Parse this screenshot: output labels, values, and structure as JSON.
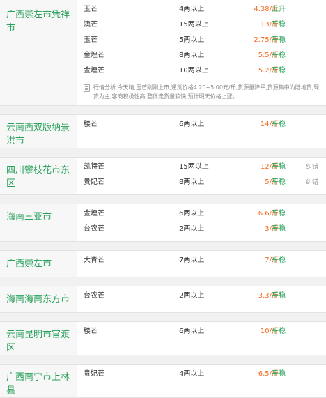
{
  "blocks": [
    {
      "region": "广西崇左市凭祥市",
      "rows": [
        {
          "name": "玉芒",
          "amount": "4两以上",
          "price": "4.38/斤",
          "trend": "上升",
          "tag": ""
        },
        {
          "name": "澳芒",
          "amount": "15两以上",
          "price": "13/斤",
          "trend": "平稳",
          "tag": ""
        },
        {
          "name": "玉芒",
          "amount": "5两以上",
          "price": "2.75/斤",
          "trend": "平稳",
          "tag": ""
        },
        {
          "name": "金煌芒",
          "amount": "8两以上",
          "price": "5.5/斤",
          "trend": "平稳",
          "tag": ""
        },
        {
          "name": "金煌芒",
          "amount": "10两以上",
          "price": "5.2/斤",
          "trend": "平稳",
          "tag": ""
        }
      ],
      "analysis": "行情分析 今天晴,玉芒刚刚上市,通货价格4.20~5.00元/斤,货源量降平,货源集中为陆地货,现货为主,客商积极性高,整体走货量较快,预计明天价格上涨。"
    },
    {
      "region": "云南西双版纳景洪市",
      "rows": [
        {
          "name": "腰芒",
          "amount": "6两以上",
          "price": "14/斤",
          "trend": "平稳",
          "tag": ""
        }
      ]
    },
    {
      "region": "四川攀枝花市东区",
      "rows": [
        {
          "name": "凯特芒",
          "amount": "15两以上",
          "price": "12/斤",
          "trend": "平稳",
          "tag": "纠错"
        },
        {
          "name": "贵妃芒",
          "amount": "8两以上",
          "price": "5/斤",
          "trend": "平稳",
          "tag": "纠错"
        }
      ]
    },
    {
      "region": "海南三亚市",
      "rows": [
        {
          "name": "金煌芒",
          "amount": "6两以上",
          "price": "6.6/斤",
          "trend": "平稳",
          "tag": ""
        },
        {
          "name": "台农芒",
          "amount": "2两以上",
          "price": "3/斤",
          "trend": "平稳",
          "tag": ""
        }
      ]
    },
    {
      "region": "广西崇左市",
      "rows": [
        {
          "name": "大青芒",
          "amount": "7两以上",
          "price": "7/斤",
          "trend": "平稳",
          "tag": ""
        }
      ]
    },
    {
      "region": "海南海南东方市",
      "rows": [
        {
          "name": "台农芒",
          "amount": "2两以上",
          "price": "3.3/斤",
          "trend": "平稳",
          "tag": ""
        }
      ]
    },
    {
      "region": "云南昆明市官渡区",
      "rows": [
        {
          "name": "腰芒",
          "amount": "6两以上",
          "price": "10/斤",
          "trend": "平稳",
          "tag": ""
        }
      ]
    },
    {
      "region": "广西南宁市上林县",
      "rows": [
        {
          "name": "贵妃芒",
          "amount": "4两以上",
          "price": "6.5/斤",
          "trend": "平稳",
          "tag": ""
        }
      ]
    }
  ],
  "colors": {
    "region": "#27a05a",
    "price": "#f36c21",
    "trend": "#27a05a",
    "region_bg": "#f7f7f7",
    "page_bg": "#f1f1f1"
  },
  "icons": {
    "analysis": "document-icon"
  }
}
